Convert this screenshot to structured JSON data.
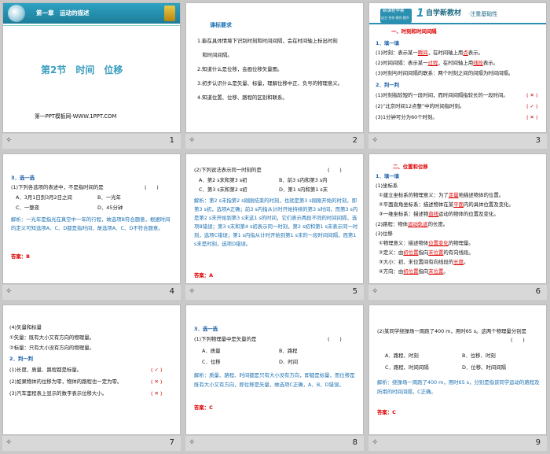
{
  "slides": [
    {
      "num": "1",
      "chapter": "第一章　运动的描述",
      "section": "第2节　时间　位移",
      "footer": "第一PPT模板网-WWW.1PPT.COM"
    },
    {
      "num": "2",
      "title": "课标要求",
      "items": [
        "1.能在具体情境下识别时刻和时间间隔，会在时间轴上标出时刻",
        "　和时间间隔。",
        "2.知道什么是位移，会画位移矢量图。",
        "3.初步认识什么是矢量、标量，理解位移中正、负号的物理意义。",
        "4.知道位置、位移、路程的区别和联系。"
      ]
    },
    {
      "num": "3",
      "badge": "新课程学案",
      "badge_sub": "自主·合作·探究·提升",
      "big_num": "1",
      "header": "自学新教材",
      "header2": "·注重基础性",
      "sec": "一、时刻和时间间隔",
      "fill": "1．填一填",
      "lines": [
        "(1)时刻：表示某一",
        "瞬间",
        "，在时间轴上用",
        "点",
        "表示。",
        "(2)时间间隔：表示某一",
        "过程",
        "，在时间轴上用",
        "线段",
        "表示。",
        "(3)时刻与时间间隔的联系：两个时刻之间的间隔为时间间隔。"
      ],
      "judge": "2．判一判",
      "j1": "(1)时刻指较短的一段时间，而时间间隔指较长的一段时间。",
      "j1a": "( ✕ )",
      "j2": "(2)“北京时间12点整”中的时间指时刻。",
      "j2a": "( ✓ )",
      "j3": "(3)1分钟可分为60个时刻。",
      "j3a": "( ✕ )"
    },
    {
      "num": "4",
      "q": "3．选一选",
      "q1": "(1)下列各选项的表述中，不是指时间的是",
      "paren": "(　　)",
      "opts": [
        "A．3月1日到3月2日之间",
        "B．一光年",
        "C．一整夜",
        "D．45分钟"
      ],
      "exp": "解析：一光年是指光在真空中一年的行程，故选项B符合题意，根据时间的定义可知选项A、C、D都是指时间，故选项A、C、D不符合题意。",
      "ans": "答案：B"
    },
    {
      "num": "5",
      "q": "(2)下列说法表示同一时刻的是",
      "paren": "(　　)",
      "opts": [
        "A．第2 s末和第3 s初",
        "B．前3 s内和第3 s内",
        "C．第3 s末和第2 s初",
        "D．第1 s内和第1 s末"
      ],
      "exp": "解析：第2 s末指第2 s刚刚结束的时刻，也就是第3 s刚刚开始的时刻，即第3 s初，选项A正确；前3 s内指从计时开始持续的第3 s时间，而第3 s内是第2 s末开始到第3 s末这1 s的时间，它们表示两段不同的时间间隔，选项B错误；第3 s末和第4 s初表示同一时刻，第2 s初和第1 s末表示同一时刻，选项C错误；第1 s内指从计时开始到第1 s末的一段时间间隔，而第1 s末是时刻，选项D错误。",
      "ans": "答案：A"
    },
    {
      "num": "6",
      "sec": "二、位置和位移",
      "fill": "1．填一填",
      "items": [
        "(1)坐标系",
        "①建立坐标系的物理意义：为了",
        "定量",
        "地描述物体的位置。",
        "②平面直角坐标系：描述物体在某",
        "平面",
        "内的具体位置及变化。",
        "③一维坐标系：描述物",
        "直线",
        "运动的物体的位置及变化。",
        "(2)路程：物体",
        "运动轨迹",
        "的长度。",
        "(3)位移",
        "①物理意义：描述物体",
        "位置变化",
        "的物理量。",
        "②定义：由",
        "初位置",
        "指向",
        "末位置",
        "的有向线段。",
        "③大小：初、末位置间有向线段的",
        "长度",
        "。",
        "④方向：由",
        "初位置",
        "指向",
        "末位置",
        "。"
      ]
    },
    {
      "num": "7",
      "items": [
        "(4)矢量和标量",
        "①矢量：既有大小又有方向的物理量。",
        "②标量：只有大小没有方向的物理量。"
      ],
      "judge": "2．判一判",
      "j1": "(1)长度、质量、路程都是标量。",
      "j1a": "( ✓ )",
      "j2": "(2)如果物体的位移为零，物体的路程也一定为零。",
      "j2a": "( ✕ )",
      "j3": "(3)汽车里程表上显示的数字表示位移大小。",
      "j3a": "( ✕ )"
    },
    {
      "num": "8",
      "q": "3．选一选",
      "q1": "(1)下列物理量中是矢量的是",
      "paren": "(　　)",
      "opts": [
        "A．质量",
        "B．路程",
        "C．位移",
        "D．时间"
      ],
      "exp": "解析：质量、路程、时间都是只有大小没有方向，即都是标量，而位移是既有大小又有方向，即位移是矢量，故选项C正确，A、B、D错误。",
      "ans": "答案：C"
    },
    {
      "num": "9",
      "q1": "(2)某同学绕操场一周跑了400 m，用时65 s。这两个物理量分别是",
      "paren": "(　　)",
      "opts": [
        "A．路程、时刻",
        "B．位移、时刻",
        "C．路程、时间间隔",
        "D．位移、时间间隔"
      ],
      "exp": "解析：绕操场一周跑了400 m，用时65 s，分别是指该同学运动的路程及所用的时间间隔，C正确。",
      "ans": "答案：C"
    }
  ],
  "colors": {
    "teal": "#2a8fb0",
    "darkbar": "#1c6a82",
    "red": "#d00000",
    "blue": "#1a6fb0"
  }
}
